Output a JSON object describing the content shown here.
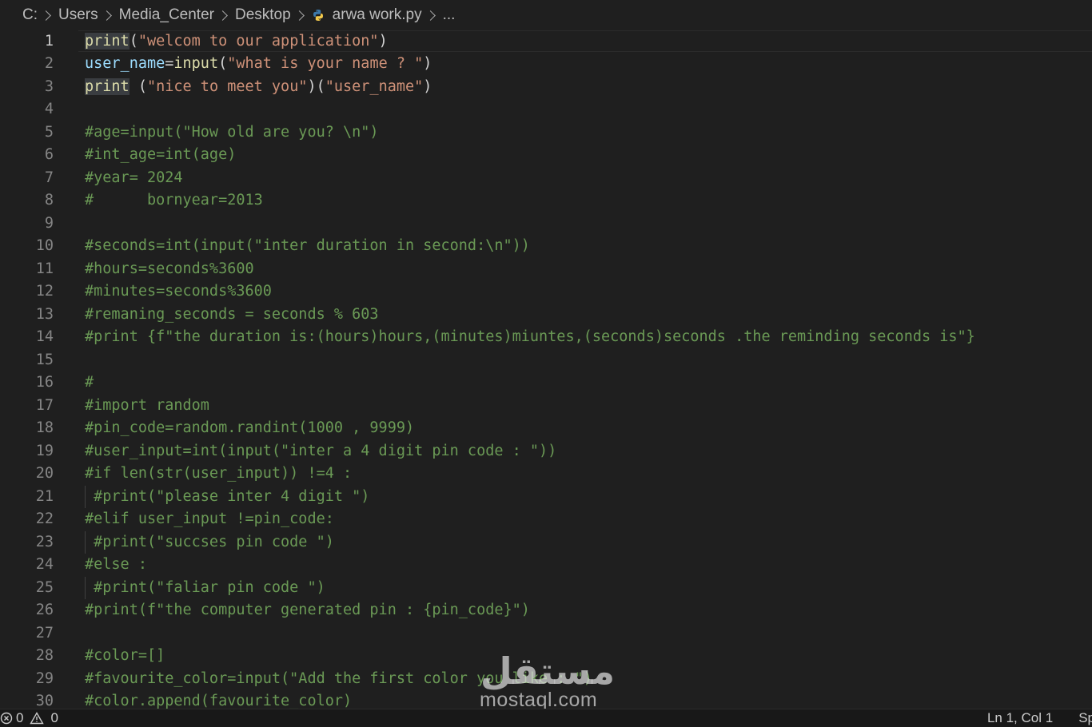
{
  "breadcrumb": {
    "items": [
      "C:",
      "Users",
      "Media_Center",
      "Desktop"
    ],
    "file": "arwa work.py",
    "ellipsis": "..."
  },
  "editor": {
    "lines": [
      {
        "n": "1",
        "tokens": [
          {
            "t": "print",
            "c": "kw-fn hl"
          },
          {
            "t": "(",
            "c": "plain"
          },
          {
            "t": "\"welcom to our application\"",
            "c": "str"
          },
          {
            "t": ")",
            "c": "plain"
          }
        ]
      },
      {
        "n": "2",
        "tokens": [
          {
            "t": "user_name",
            "c": "var"
          },
          {
            "t": "=",
            "c": "plain"
          },
          {
            "t": "input",
            "c": "kw-fn"
          },
          {
            "t": "(",
            "c": "plain"
          },
          {
            "t": "\"what is your name ? \"",
            "c": "str"
          },
          {
            "t": ")",
            "c": "plain"
          }
        ]
      },
      {
        "n": "3",
        "tokens": [
          {
            "t": "print",
            "c": "kw-fn hl"
          },
          {
            "t": " (",
            "c": "plain"
          },
          {
            "t": "\"nice to meet you\"",
            "c": "str"
          },
          {
            "t": ")(",
            "c": "plain"
          },
          {
            "t": "\"user_name\"",
            "c": "str"
          },
          {
            "t": ")",
            "c": "plain"
          }
        ]
      },
      {
        "n": "4",
        "tokens": []
      },
      {
        "n": "5",
        "tokens": [
          {
            "t": "#age=input(\"How old are you? \\n\")",
            "c": "cmt"
          }
        ]
      },
      {
        "n": "6",
        "tokens": [
          {
            "t": "#int_age=int(age)",
            "c": "cmt"
          }
        ]
      },
      {
        "n": "7",
        "tokens": [
          {
            "t": "#year= 2024",
            "c": "cmt"
          }
        ]
      },
      {
        "n": "8",
        "tokens": [
          {
            "t": "#      bornyear=2013",
            "c": "cmt"
          }
        ]
      },
      {
        "n": "9",
        "tokens": []
      },
      {
        "n": "10",
        "tokens": [
          {
            "t": "#seconds=int(input(\"inter duration in second:\\n\"))",
            "c": "cmt"
          }
        ]
      },
      {
        "n": "11",
        "tokens": [
          {
            "t": "#hours=seconds%3600",
            "c": "cmt"
          }
        ]
      },
      {
        "n": "12",
        "tokens": [
          {
            "t": "#minutes=seconds%3600",
            "c": "cmt"
          }
        ]
      },
      {
        "n": "13",
        "tokens": [
          {
            "t": "#remaning_seconds = seconds % 603",
            "c": "cmt"
          }
        ]
      },
      {
        "n": "14",
        "tokens": [
          {
            "t": "#print {f\"the duration is:(hours)hours,(minutes)miuntes,(seconds)seconds .the reminding seconds is\"}",
            "c": "cmt"
          }
        ]
      },
      {
        "n": "15",
        "tokens": []
      },
      {
        "n": "16",
        "tokens": [
          {
            "t": "#",
            "c": "cmt"
          }
        ]
      },
      {
        "n": "17",
        "tokens": [
          {
            "t": "#import random",
            "c": "cmt"
          }
        ]
      },
      {
        "n": "18",
        "tokens": [
          {
            "t": "#pin_code=random.randint(1000 , 9999)",
            "c": "cmt"
          }
        ]
      },
      {
        "n": "19",
        "tokens": [
          {
            "t": "#user_input=int(input(\"inter a 4 digit pin code : \"))",
            "c": "cmt"
          }
        ]
      },
      {
        "n": "20",
        "tokens": [
          {
            "t": "#if len(str(user_input)) !=4 :",
            "c": "cmt"
          }
        ]
      },
      {
        "n": "21",
        "tokens": [
          {
            "t": " #print(\"please inter 4 digit \")",
            "c": "cmt"
          }
        ],
        "guide": true
      },
      {
        "n": "22",
        "tokens": [
          {
            "t": "#elif user_input !=pin_code:",
            "c": "cmt"
          }
        ]
      },
      {
        "n": "23",
        "tokens": [
          {
            "t": " #print(\"succses pin code \")",
            "c": "cmt"
          }
        ],
        "guide": true
      },
      {
        "n": "24",
        "tokens": [
          {
            "t": "#else :",
            "c": "cmt"
          }
        ]
      },
      {
        "n": "25",
        "tokens": [
          {
            "t": " #print(\"faliar pin code \")",
            "c": "cmt"
          }
        ],
        "guide": true
      },
      {
        "n": "26",
        "tokens": [
          {
            "t": "#print(f\"the computer generated pin : {pin_code}\")",
            "c": "cmt"
          }
        ]
      },
      {
        "n": "27",
        "tokens": []
      },
      {
        "n": "28",
        "tokens": [
          {
            "t": "#color=[]",
            "c": "cmt"
          }
        ]
      },
      {
        "n": "29",
        "tokens": [
          {
            "t": "#favourite_color=input(\"Add the first color you like : \")",
            "c": "cmt"
          }
        ]
      },
      {
        "n": "30",
        "tokens": [
          {
            "t": "#color.append(favourite_color)",
            "c": "cmt"
          }
        ]
      }
    ]
  },
  "watermark": {
    "logo_text": "مستقل",
    "domain": "mostaql.com"
  },
  "status": {
    "errors": "0",
    "warnings": "0",
    "position": "Ln 1, Col 1",
    "trailing": "Sp"
  },
  "colors": {
    "background": "#1f1f1f",
    "function": "#dcdcaa",
    "variable": "#9cdcfe",
    "string": "#ce9178",
    "comment": "#6a9955",
    "line_number": "#858585"
  }
}
